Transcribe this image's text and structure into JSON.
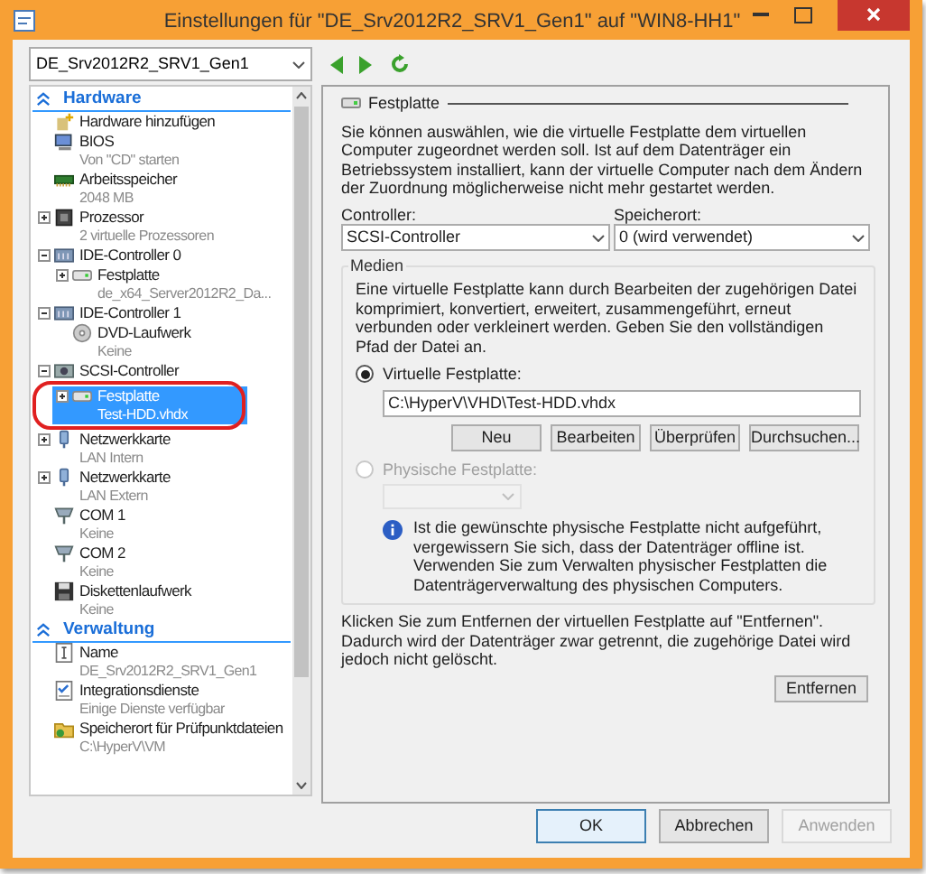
{
  "window": {
    "title": "Einstellungen für \"DE_Srv2012R2_SRV1_Gen1\" auf \"WIN8-HH1\""
  },
  "vm_selector": {
    "value": "DE_Srv2012R2_SRV1_Gen1"
  },
  "tree": [
    {
      "kind": "section",
      "label": "Hardware",
      "children": [
        {
          "kind": "add",
          "label": "Hardware hinzufügen",
          "selected": false
        },
        {
          "kind": "bios",
          "label": "BIOS",
          "detail": "Von \"CD\" starten",
          "selected": false
        },
        {
          "kind": "memory",
          "label": "Arbeitsspeicher",
          "detail": "2048 MB",
          "selected": false
        },
        {
          "kind": "cpu",
          "label": "Prozessor",
          "detail": "2 virtuelle Prozessoren",
          "expanded": false,
          "selected": false
        },
        {
          "kind": "controller",
          "label": "IDE-Controller 0",
          "expanded": true,
          "selected": false,
          "children": [
            {
              "kind": "disk",
              "label": "Festplatte",
              "detail": "de_x64_Server2012R2_Da...",
              "expanded": false,
              "selected": false
            }
          ]
        },
        {
          "kind": "controller",
          "label": "IDE-Controller 1",
          "expanded": true,
          "selected": false,
          "children": [
            {
              "kind": "dvd",
              "label": "DVD-Laufwerk",
              "detail": "Keine",
              "selected": false
            }
          ]
        },
        {
          "kind": "scsi",
          "label": "SCSI-Controller",
          "expanded": true,
          "selected": false,
          "children": [
            {
              "kind": "disk",
              "label": "Festplatte",
              "detail": "Test-HDD.vhdx",
              "expanded": false,
              "selected": true,
              "annotated": true
            }
          ]
        },
        {
          "kind": "nic",
          "label": "Netzwerkkarte",
          "detail": "LAN Intern",
          "expanded": false,
          "selected": false
        },
        {
          "kind": "nic",
          "label": "Netzwerkkarte",
          "detail": "LAN Extern",
          "expanded": false,
          "selected": false
        },
        {
          "kind": "com",
          "label": "COM 1",
          "detail": "Keine",
          "selected": false
        },
        {
          "kind": "com",
          "label": "COM 2",
          "detail": "Keine",
          "selected": false
        },
        {
          "kind": "floppy",
          "label": "Diskettenlaufwerk",
          "detail": "Keine",
          "selected": false
        }
      ]
    },
    {
      "kind": "section",
      "label": "Verwaltung",
      "children": [
        {
          "kind": "name",
          "label": "Name",
          "detail": "DE_Srv2012R2_SRV1_Gen1",
          "selected": false
        },
        {
          "kind": "integration",
          "label": "Integrationsdienste",
          "detail": "Einige Dienste verfügbar",
          "selected": false
        },
        {
          "kind": "folder",
          "label": "Speicherort für Prüfpunktdateien",
          "detail": "C:\\HyperV\\VM",
          "selected": false
        }
      ]
    }
  ],
  "panel": {
    "title": "Festplatte",
    "intro": "Sie können auswählen, wie die virtuelle Festplatte dem virtuellen Computer zugeordnet werden soll. Ist auf dem Datenträger ein Betriebssystem installiert, kann der virtuelle Computer nach dem Ändern der Zuordnung möglicherweise nicht mehr gestartet werden.",
    "controller": {
      "label": "Controller:",
      "value": "SCSI-Controller"
    },
    "location": {
      "label": "Speicherort:",
      "value": "0 (wird verwendet)"
    },
    "media": {
      "title": "Medien",
      "description": "Eine virtuelle Festplatte kann durch Bearbeiten der zugehörigen Datei komprimiert, konvertiert, erweitert, zusammengeführt, erneut verbunden oder verkleinert werden. Geben Sie den vollständigen Pfad der Datei an.",
      "options": [
        {
          "label": "Virtuelle Festplatte:",
          "selected": true,
          "disabled": false
        },
        {
          "label": "Physische Festplatte:",
          "selected": false,
          "disabled": true
        }
      ],
      "path": "C:\\HyperV\\VHD\\Test-HDD.vhdx",
      "buttons": [
        "Neu",
        "Bearbeiten",
        "Überprüfen",
        "Durchsuchen..."
      ],
      "info": "Ist die gewünschte physische Festplatte nicht aufgeführt, vergewissern Sie sich, dass der Datenträger offline ist. Verwenden Sie zum Verwalten physischer Festplatten die Datenträgerverwaltung des physischen Computers."
    },
    "remove_hint": "Klicken Sie zum Entfernen der virtuellen Festplatte auf \"Entfernen\". Dadurch wird der Datenträger zwar getrennt, die zugehörige Datei wird jedoch nicht gelöscht.",
    "remove_button": "Entfernen"
  },
  "footer_buttons": [
    {
      "label": "OK",
      "kind": "default",
      "disabled": false
    },
    {
      "label": "Abbrechen",
      "kind": "normal",
      "disabled": false
    },
    {
      "label": "Anwenden",
      "kind": "normal",
      "disabled": true
    }
  ]
}
